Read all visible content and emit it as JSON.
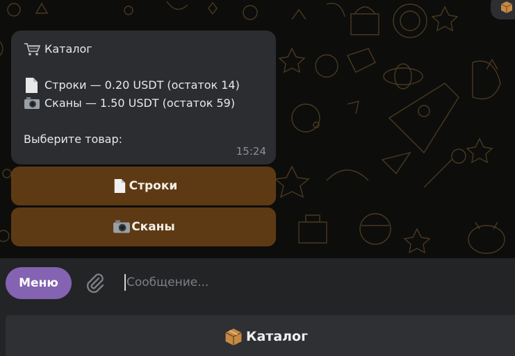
{
  "message": {
    "title_icon": "cart-icon",
    "title": "Каталог",
    "items": [
      {
        "icon": "page-icon",
        "text": "Строки — 0.20 USDT (остаток 14)"
      },
      {
        "icon": "camera-icon",
        "text": "Сканы — 1.50 USDT (остаток 59)"
      }
    ],
    "prompt": "Выберите товар:",
    "time": "15:24"
  },
  "inline_buttons": [
    {
      "icon": "page-icon",
      "label": "Строки"
    },
    {
      "icon": "camera-icon",
      "label": "Сканы"
    }
  ],
  "composer": {
    "menu_label": "Меню",
    "attach_icon": "paperclip-icon",
    "placeholder": "Сообщение...",
    "value": ""
  },
  "reply_keyboard": {
    "icon": "package-icon",
    "label": "Каталог"
  },
  "colors": {
    "bubble": "#2b2d31",
    "inline_button": "#5e3a14",
    "menu_button": "#8463b2",
    "wallpaper_doodle": "#4a3a1f"
  }
}
